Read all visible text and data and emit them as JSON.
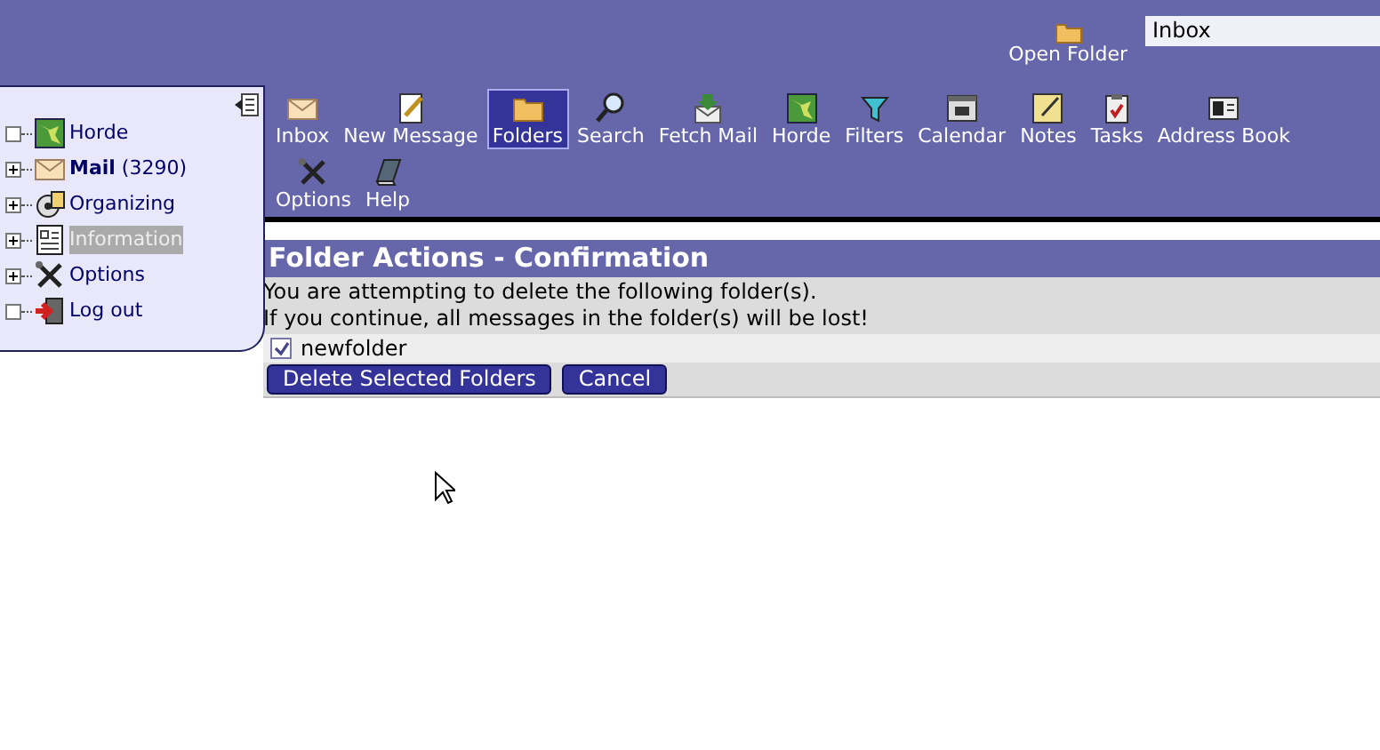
{
  "open_folder": {
    "label": "Open Folder",
    "value": "Inbox"
  },
  "sidebar": {
    "items": [
      {
        "label": "Horde",
        "expandable": false,
        "selected": false,
        "kind": "map"
      },
      {
        "label": "**Mail** (3290)",
        "expandable": true,
        "selected": false,
        "kind": "mail"
      },
      {
        "label": "Organizing",
        "expandable": true,
        "selected": false,
        "kind": "gear"
      },
      {
        "label": "Information",
        "expandable": true,
        "selected": true,
        "kind": "doc"
      },
      {
        "label": "Options",
        "expandable": true,
        "selected": false,
        "kind": "tools"
      },
      {
        "label": "Log out",
        "expandable": false,
        "selected": false,
        "kind": "exit"
      }
    ]
  },
  "toolbar": [
    {
      "label": "Inbox",
      "kind": "mail",
      "selected": false
    },
    {
      "label": "New Message",
      "kind": "pen",
      "selected": false
    },
    {
      "label": "Folders",
      "kind": "folder",
      "selected": true
    },
    {
      "label": "Search",
      "kind": "search",
      "selected": false
    },
    {
      "label": "Fetch Mail",
      "kind": "fetch",
      "selected": false
    },
    {
      "label": "Horde",
      "kind": "map",
      "selected": false
    },
    {
      "label": "Filters",
      "kind": "funnel",
      "selected": false
    },
    {
      "label": "Calendar",
      "kind": "calendar",
      "selected": false
    },
    {
      "label": "Notes",
      "kind": "note",
      "selected": false
    },
    {
      "label": "Tasks",
      "kind": "clipboard",
      "selected": false
    },
    {
      "label": "Address Book",
      "kind": "card",
      "selected": false
    },
    {
      "label": "Options",
      "kind": "tools",
      "selected": false
    },
    {
      "label": "Help",
      "kind": "book",
      "selected": false
    }
  ],
  "confirmation": {
    "title": "Folder Actions - Confirmation",
    "messages": [
      "You are attempting to delete the following folder(s).",
      "If you continue, all messages in the folder(s) will be lost!"
    ],
    "folders": [
      {
        "name": "newfolder",
        "checked": true
      }
    ],
    "buttons": [
      "Delete Selected Folders",
      "Cancel"
    ]
  }
}
